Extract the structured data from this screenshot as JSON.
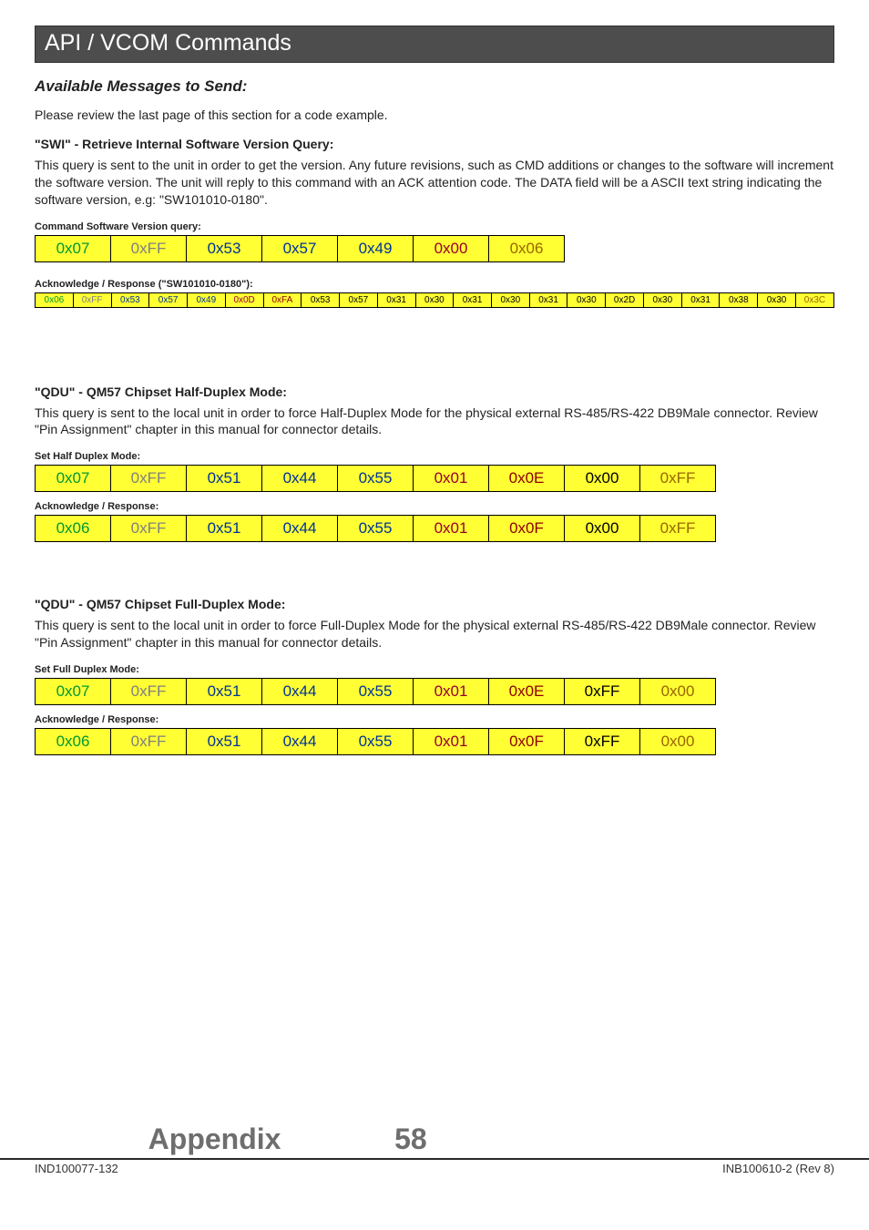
{
  "title": "API / VCOM Commands",
  "subhead": "Available Messages to Send:",
  "intro": "Please review the last page of this section for a code example.",
  "swi": {
    "heading": "\"SWI\" - Retrieve Internal Software Version Query:",
    "body": "This query is sent to the unit in order to get the version. Any future revisions, such as CMD additions or changes to the software will increment the software version. The unit will reply to this command with an ACK attention code. The DATA field will be a ASCII text string indicating the software version, e.g: \"SW101010-0180\".",
    "cmd_label": "Command Software Version query:",
    "cmd_bytes": [
      {
        "v": "0x07",
        "c": "c-green"
      },
      {
        "v": "0xFF",
        "c": "c-grey"
      },
      {
        "v": "0x53",
        "c": "c-navy"
      },
      {
        "v": "0x57",
        "c": "c-navy"
      },
      {
        "v": "0x49",
        "c": "c-navy"
      },
      {
        "v": "0x00",
        "c": "c-maroon"
      },
      {
        "v": "0x06",
        "c": "c-olive"
      }
    ],
    "ack_label": "Acknowledge / Response (\"SW101010-0180\"):",
    "ack_bytes": [
      {
        "v": "0x06",
        "c": "c-green"
      },
      {
        "v": "0xFF",
        "c": "c-grey"
      },
      {
        "v": "0x53",
        "c": "c-navy"
      },
      {
        "v": "0x57",
        "c": "c-navy"
      },
      {
        "v": "0x49",
        "c": "c-navy"
      },
      {
        "v": "0x0D",
        "c": "c-maroon"
      },
      {
        "v": "0xFA",
        "c": "c-darkred"
      },
      {
        "v": "0x53",
        "c": "c-yellow"
      },
      {
        "v": "0x57",
        "c": "c-yellow"
      },
      {
        "v": "0x31",
        "c": "c-yellow"
      },
      {
        "v": "0x30",
        "c": "c-yellow"
      },
      {
        "v": "0x31",
        "c": "c-yellow"
      },
      {
        "v": "0x30",
        "c": "c-yellow"
      },
      {
        "v": "0x31",
        "c": "c-yellow"
      },
      {
        "v": "0x30",
        "c": "c-yellow"
      },
      {
        "v": "0x2D",
        "c": "c-yellow"
      },
      {
        "v": "0x30",
        "c": "c-yellow"
      },
      {
        "v": "0x31",
        "c": "c-yellow"
      },
      {
        "v": "0x38",
        "c": "c-yellow"
      },
      {
        "v": "0x30",
        "c": "c-yellow"
      },
      {
        "v": "0x3C",
        "c": "c-olive"
      }
    ]
  },
  "qdu_half": {
    "heading": "\"QDU\" - QM57 Chipset Half-Duplex Mode:",
    "body": "This query is sent to the local unit in order to force Half-Duplex Mode for the physical external RS-485/RS-422 DB9Male connector. Review \"Pin Assignment\" chapter in this manual for connector details.",
    "cmd_label": "Set Half Duplex Mode:",
    "cmd_bytes": [
      {
        "v": "0x07",
        "c": "c-green"
      },
      {
        "v": "0xFF",
        "c": "c-grey"
      },
      {
        "v": "0x51",
        "c": "c-navy"
      },
      {
        "v": "0x44",
        "c": "c-navy"
      },
      {
        "v": "0x55",
        "c": "c-navy"
      },
      {
        "v": "0x01",
        "c": "c-maroon"
      },
      {
        "v": "0x0E",
        "c": "c-darkred"
      },
      {
        "v": "0x00",
        "c": "c-yellow"
      },
      {
        "v": "0xFF",
        "c": "c-olive"
      }
    ],
    "ack_label": "Acknowledge / Response:",
    "ack_bytes": [
      {
        "v": "0x06",
        "c": "c-green"
      },
      {
        "v": "0xFF",
        "c": "c-grey"
      },
      {
        "v": "0x51",
        "c": "c-navy"
      },
      {
        "v": "0x44",
        "c": "c-navy"
      },
      {
        "v": "0x55",
        "c": "c-navy"
      },
      {
        "v": "0x01",
        "c": "c-maroon"
      },
      {
        "v": "0x0F",
        "c": "c-darkred"
      },
      {
        "v": "0x00",
        "c": "c-yellow"
      },
      {
        "v": "0xFF",
        "c": "c-olive"
      }
    ]
  },
  "qdu_full": {
    "heading": "\"QDU\" - QM57 Chipset Full-Duplex Mode:",
    "body": "This query is sent to the local unit in order to force Full-Duplex Mode for the physical external RS-485/RS-422 DB9Male connector. Review \"Pin Assignment\" chapter in this manual for connector details.",
    "cmd_label": "Set Full Duplex Mode:",
    "cmd_bytes": [
      {
        "v": "0x07",
        "c": "c-green"
      },
      {
        "v": "0xFF",
        "c": "c-grey"
      },
      {
        "v": "0x51",
        "c": "c-navy"
      },
      {
        "v": "0x44",
        "c": "c-navy"
      },
      {
        "v": "0x55",
        "c": "c-navy"
      },
      {
        "v": "0x01",
        "c": "c-maroon"
      },
      {
        "v": "0x0E",
        "c": "c-darkred"
      },
      {
        "v": "0xFF",
        "c": "c-yellow"
      },
      {
        "v": "0x00",
        "c": "c-olive"
      }
    ],
    "ack_label": "Acknowledge / Response:",
    "ack_bytes": [
      {
        "v": "0x06",
        "c": "c-green"
      },
      {
        "v": "0xFF",
        "c": "c-grey"
      },
      {
        "v": "0x51",
        "c": "c-navy"
      },
      {
        "v": "0x44",
        "c": "c-navy"
      },
      {
        "v": "0x55",
        "c": "c-navy"
      },
      {
        "v": "0x01",
        "c": "c-maroon"
      },
      {
        "v": "0x0F",
        "c": "c-darkred"
      },
      {
        "v": "0xFF",
        "c": "c-yellow"
      },
      {
        "v": "0x00",
        "c": "c-olive"
      }
    ]
  },
  "footer": {
    "appendix": "Appendix",
    "page": "58",
    "left": "IND100077-132",
    "right": "INB100610-2 (Rev 8)"
  }
}
